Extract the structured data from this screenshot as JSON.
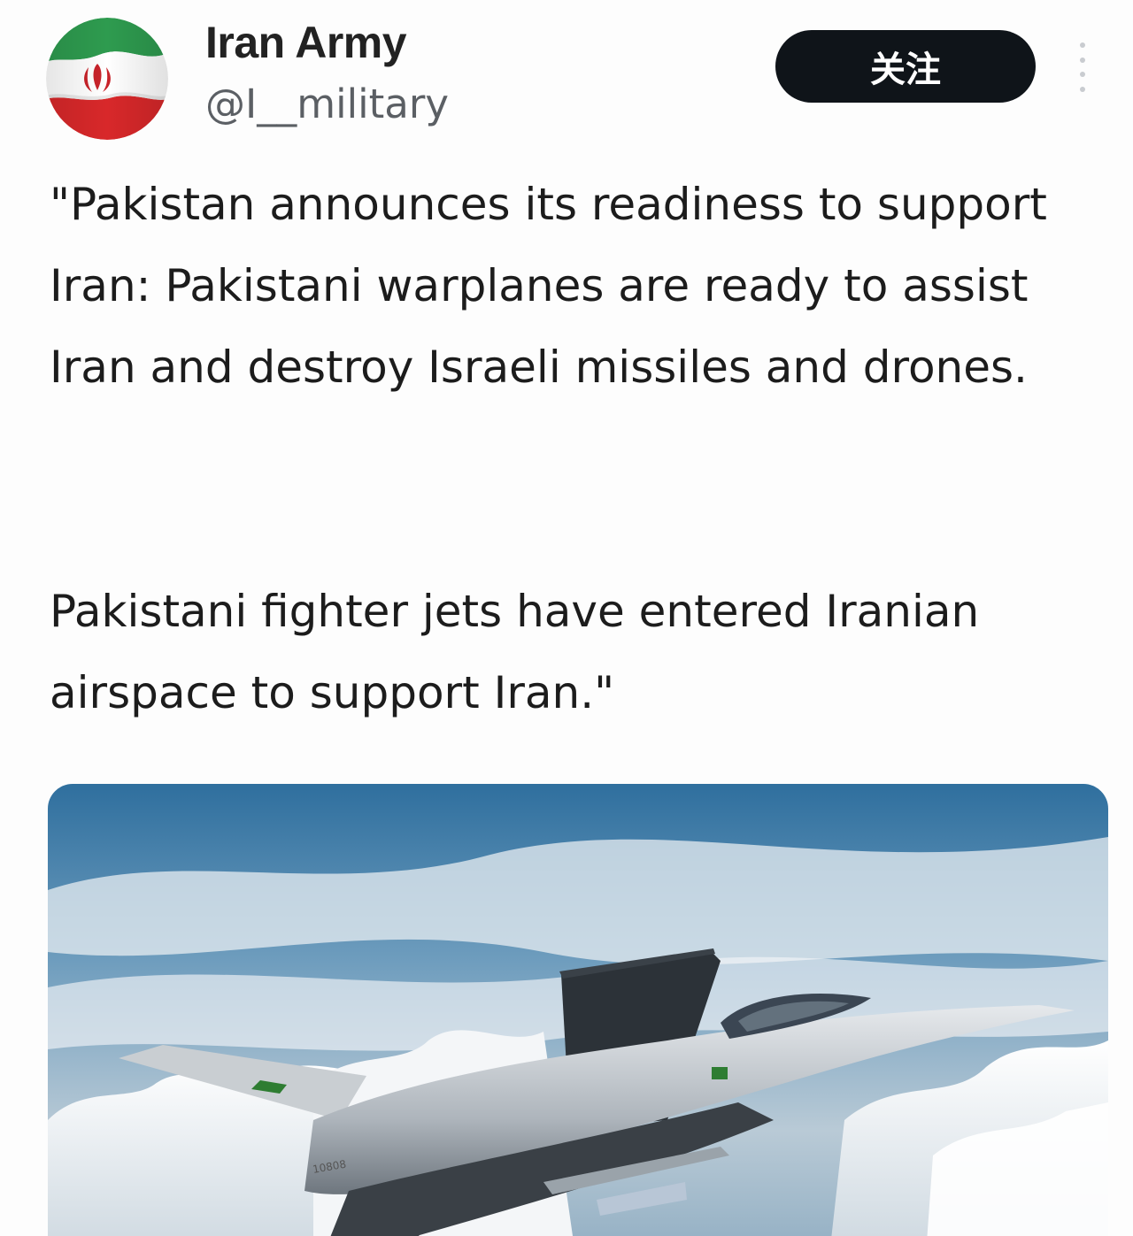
{
  "author": {
    "display_name": "Iran Army",
    "handle": "@I__military",
    "avatar_icon": "iran-flag-icon"
  },
  "header": {
    "follow_label": "关注",
    "more_icon": "more-vertical-icon"
  },
  "post": {
    "paragraphs": [
      "\"Pakistan announces its readiness to support Iran: Pakistani warplanes are ready to assist Iran and destroy Israeli missiles and drones.",
      "Pakistani fighter jets have entered Iranian airspace to support Iran.\""
    ]
  },
  "media": {
    "type": "photo",
    "tail_serial": "10808"
  },
  "colors": {
    "follow_button_bg": "#0f1419",
    "handle_text": "#5b5f64",
    "flag_green": "#2e9b4f",
    "flag_red": "#d8282a",
    "flag_white": "#ffffff",
    "sky_top": "#2f6f9e"
  }
}
